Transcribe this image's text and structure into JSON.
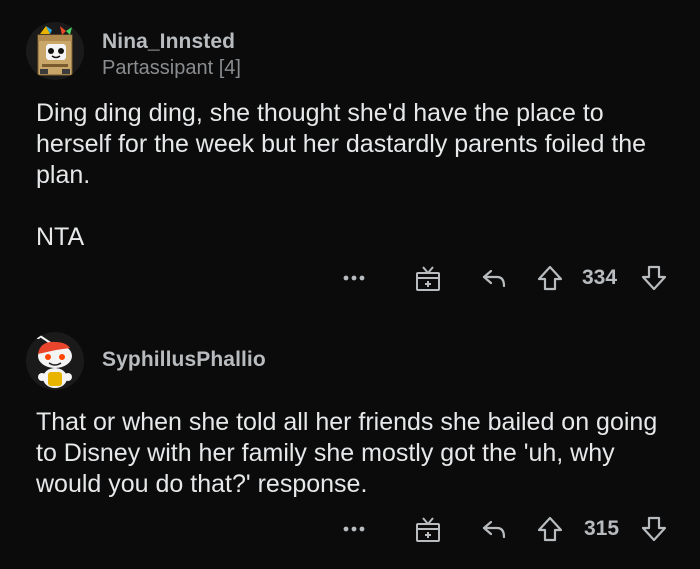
{
  "comments": [
    {
      "username": "Nina_Innsted",
      "flair": "Partassipant [4]",
      "body": [
        "Ding ding ding, she thought she'd have the place to herself for the week but her dastardly parents foiled the plan.",
        "NTA"
      ],
      "score": "334",
      "avatar_icon": "snoo-box-costume-avatar-icon"
    },
    {
      "username": "SyphillusPhallio",
      "body": [
        "That or when she told all her friends she bailed on going to Disney with her family she mostly got the 'uh, why would you do that?' response."
      ],
      "score": "315",
      "avatar_icon": "snoo-avatar-icon"
    }
  ],
  "icons": {
    "more": "ellipsis-icon",
    "award": "gift-award-icon",
    "reply": "reply-arrow-icon",
    "upvote": "upvote-arrow-icon",
    "downvote": "downvote-arrow-icon"
  },
  "colors": {
    "background": "#0b0b0b",
    "text": "#e6e8ea",
    "muted": "#8a8d90",
    "icon": "#b8bcbf"
  }
}
